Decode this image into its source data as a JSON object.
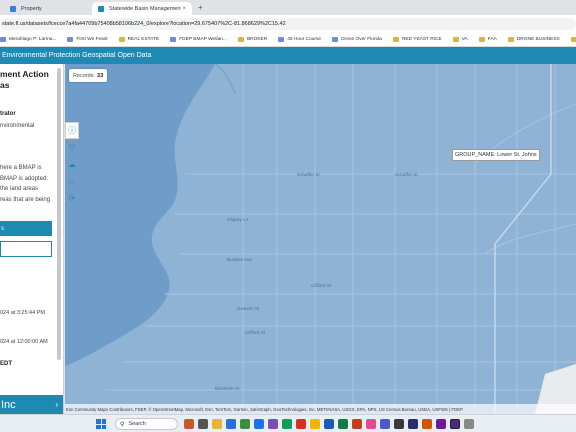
{
  "browser": {
    "tabs": [
      {
        "label": "Property",
        "active": false
      },
      {
        "label": "Statewide Basin Management...",
        "active": true
      }
    ],
    "url": "state.fl.us/datasets/fcecce7a4fa44709b75408b58106b224_0/explore?location=29.675407%2C-81.868629%2C15.42",
    "bookmarks": [
      {
        "label": "Merahlago P: Larma...",
        "folder": false
      },
      {
        "label": "First We Feast",
        "folder": false
      },
      {
        "label": "REAL ESTATE",
        "folder": true
      },
      {
        "label": "FDEP BMAP Wetlan...",
        "folder": false
      },
      {
        "label": "BROKER",
        "folder": true
      },
      {
        "label": "45 Hour Course",
        "folder": false
      },
      {
        "label": "Drone Over Florida",
        "folder": false
      },
      {
        "label": "RED YEAST RICE",
        "folder": true
      },
      {
        "label": "VA",
        "folder": true
      },
      {
        "label": "FAA",
        "folder": true
      },
      {
        "label": "DRONE BUSINESS",
        "folder": true
      },
      {
        "label": "Firearms",
        "folder": true
      },
      {
        "label": "Florida Ordinan",
        "folder": false
      }
    ]
  },
  "app": {
    "header": "Environmental Protection Geospatial Open Data"
  },
  "panel": {
    "title_line1": "ment Action",
    "title_line2": "as",
    "role": "trator",
    "org_line1": "nvironmental",
    "org_line2": "",
    "desc_line1": "here a BMAP is",
    "desc_line2": "BMAP is adopted.",
    "desc_line3": "the land areas",
    "desc_line4": "reas that are being",
    "desc_line5": "",
    "button_primary": "s",
    "date1": "024 at 3:25:44 PM",
    "date2": "024 at 12:00:00 AM",
    "tz": "EDT",
    "footer_text": "Inc",
    "footer_chevron": "›"
  },
  "map": {
    "records_label": "Records:",
    "records_count": "33",
    "tooltip": "GROUP_NAME: Lower St. Johns",
    "attribution": "Esri Community Maps Contributors, FDEP, © OpenStreetMap, Microsoft, Esri, TomTom, Garmin, SafeGraph, GeoTechnologies, Inc, METI/NASA, USGS, EPA, NPS, US Census Bureau, USDA, USFWS | FDEP",
    "streets": [
      "Schaffer St",
      "Schaffer St",
      "Osprey Ln",
      "Buckles Ave",
      "Clifford St",
      "Dawson St",
      "Clifford St",
      "Elizabeth St",
      "Blue Heron Ln",
      "Mocking Bird Ln"
    ],
    "tools": [
      "info-icon",
      "filter-icon",
      "cloud-download-icon",
      "star-icon",
      "refresh-icon"
    ],
    "colors": {
      "water": "#6f9dc9",
      "land": "#8fb3d5",
      "accent": "#1e8ab3"
    }
  },
  "taskbar": {
    "search_placeholder": "Search"
  }
}
